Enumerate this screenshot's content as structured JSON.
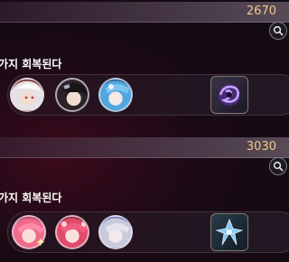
{
  "rows": [
    {
      "count": "2670",
      "description": "가지 회복된다",
      "portraits": [
        {
          "name": "white-haired-character",
          "hair": "#e6e1e4",
          "accent": "#c23a3a"
        },
        {
          "name": "dark-haired-character",
          "hair": "#2a2226",
          "accent": "#a8b0c0"
        },
        {
          "name": "blue-haired-character",
          "hair": "#4fa6e0",
          "accent": "#e8f2ff"
        }
      ],
      "reward_icon": "purple-swirl-orb-icon"
    },
    {
      "count": "3030",
      "description": "가지 회복된다",
      "portraits": [
        {
          "name": "pink-haired-character",
          "hair": "#f06a8a",
          "accent": "#ffffff"
        },
        {
          "name": "red-pink-haired-character",
          "hair": "#e04a6a",
          "accent": "#ffd0dc"
        },
        {
          "name": "silver-haired-character",
          "hair": "#c9c9dc",
          "accent": "#6a72b0"
        }
      ],
      "reward_icon": "blue-crystal-flower-icon"
    }
  ],
  "icons": {
    "search": "magnifier-icon",
    "sparkle": "sparkle-icon"
  },
  "colors": {
    "count_text": "#f2c88a",
    "description_text": "#ffffff"
  }
}
